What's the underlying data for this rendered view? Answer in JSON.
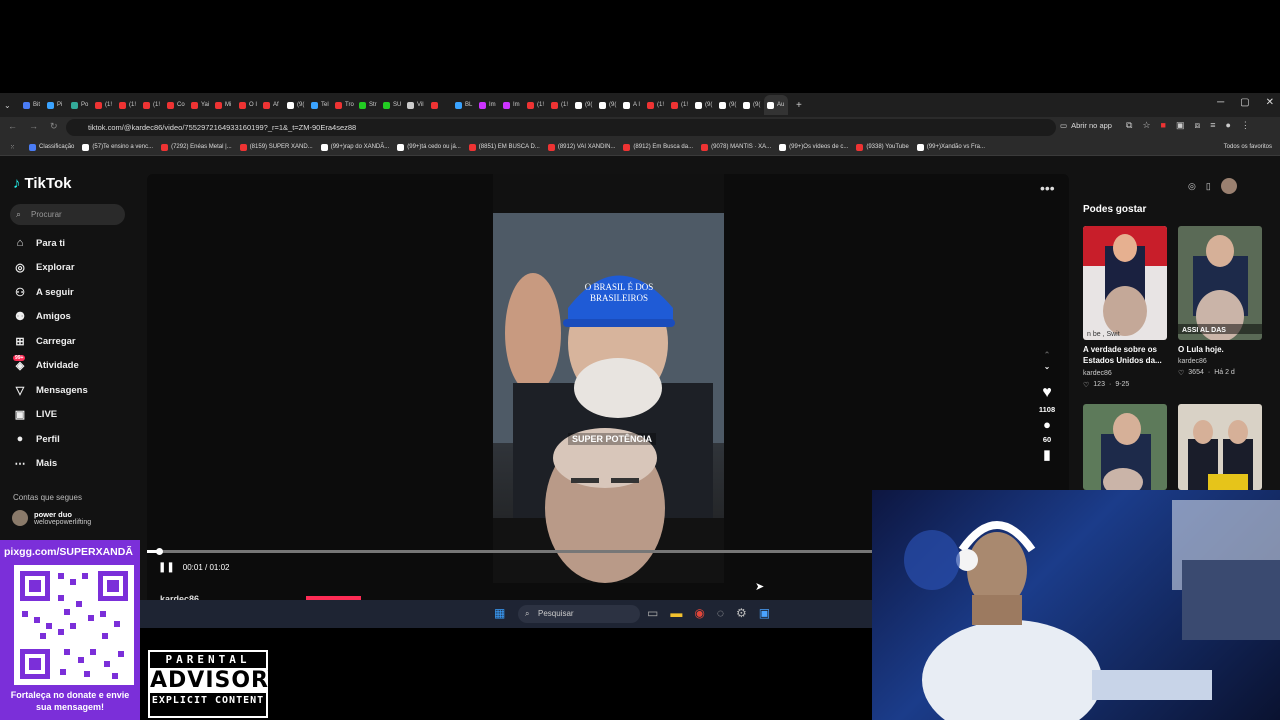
{
  "browser": {
    "tabs": [
      "Bit",
      "Pi",
      "Po",
      "(1!",
      "(1!",
      "(1!",
      "Co",
      "Yai",
      "Mi",
      "O I",
      "Af",
      "(9(",
      "Tel",
      "Tro",
      "Str",
      "SU",
      "Vil",
      "",
      "BL",
      "Im",
      "Im",
      "(1!",
      "(1!",
      "(9(",
      "(9(",
      "A I",
      "(1!",
      "(1!",
      "(9(",
      "(9(",
      "(9(",
      "Au"
    ],
    "url": "tiktok.com/@kardec86/video/7552972164933160199?_r=1&_t=ZM-90Era4sez88",
    "open_app": "Abrir no app",
    "bookmarks": [
      "Classificação",
      "(57)Te ensino a venc...",
      "(7292) Enéas Metal |...",
      "(8159) SUPER XAND...",
      "(99+)rap do XANDÃ...",
      "(99+)tá cedo ou já...",
      "(8851) EM BUSCA D...",
      "(8912) VAI XANDIN...",
      "(8912) Em Busca da...",
      "(9078) MANTIS · XA...",
      "(99+)Os vídeos de c...",
      "(9338) YouTube",
      "(99+)Xandão vs Fra..."
    ],
    "all_favorites": "Todos os favoritos"
  },
  "tiktok": {
    "logo": "TikTok",
    "search_placeholder": "Procurar",
    "nav": [
      "Para ti",
      "Explorar",
      "A seguir",
      "Amigos",
      "Carregar",
      "Atividade",
      "Mensagens",
      "LIVE",
      "Perfil",
      "Mais"
    ],
    "activity_badge": "99+",
    "following_title": "Contas que segues",
    "following": [
      {
        "name": "power duo",
        "handle": "welovepowerlifting"
      }
    ],
    "video": {
      "caption": "SUPER POTÊNCIA",
      "cap_text": "O BRASIL É DOS BRASILEIROS",
      "likes": "1108",
      "comments": "60",
      "time": "00:01 / 01:02",
      "author": "kardec86",
      "progress": 0.016
    },
    "suggested_title": "Podes gostar",
    "suggested": [
      {
        "caption": "A verdade sobre os Estados Unidos da...",
        "author": "kardec86",
        "likes": "123",
        "date": "9-25",
        "thumb_text": "n be   , Swit"
      },
      {
        "caption": "O Lula hoje.",
        "author": "kardec86",
        "likes": "3654",
        "date": "Há 2 d",
        "thumb_text": "ASSI    AL DAS"
      }
    ]
  },
  "taskbar": {
    "search": "Pesquisar"
  },
  "overlay": {
    "qr_url": "pixgg.com/SUPERXANDÃ",
    "qr_text": "Fortaleça no donate e envie sua mensagem!",
    "advisory": [
      "PARENTAL",
      "ADVISORY",
      "EXPLICIT CONTENT"
    ]
  },
  "colors": {
    "tiktok_red": "#fe2c55",
    "qr_purple": "#7b2fd9"
  }
}
